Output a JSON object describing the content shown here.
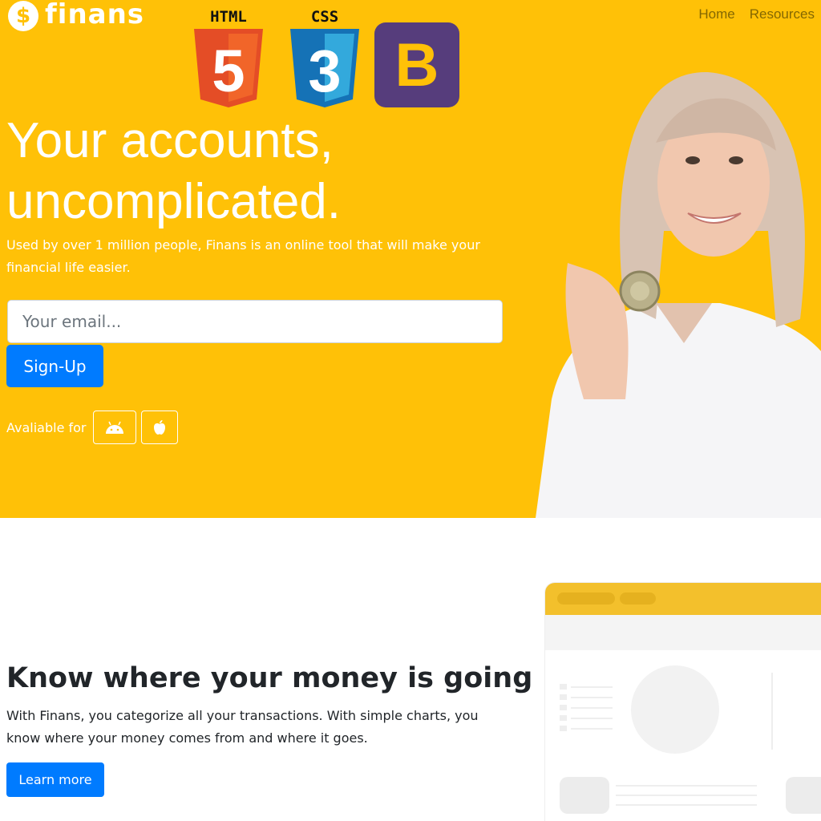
{
  "brand": {
    "name": "finans",
    "coin_symbol": "$"
  },
  "nav": {
    "items": [
      "Home",
      "Resources"
    ]
  },
  "badges": {
    "html_label": "HTML",
    "html_digit": "5",
    "css_label": "CSS",
    "css_digit": "3",
    "bootstrap_letter": "B"
  },
  "hero": {
    "headline_line1": "Your accounts,",
    "headline_line2": "uncomplicated.",
    "lead": "Used by over 1 million people, Finans is an online tool that will make your financial life easier.",
    "email_placeholder": "Your email...",
    "signup_label": "Sign-Up",
    "available_label": "Avaliable for",
    "platform_icons": [
      "android-icon",
      "apple-icon"
    ],
    "image": "woman-holding-coin"
  },
  "feature": {
    "title": "Know where your money is going",
    "text": "With Finans, you categorize all your transactions. With simple charts, you know where your money comes from and where it goes.",
    "button_label": "Learn more",
    "illustration": "app-dashboard-mockup"
  },
  "colors": {
    "primary_yellow": "#ffc107",
    "button_blue": "#007bff",
    "bootstrap_purple": "#563d7c",
    "html_orange": "#e44d26",
    "css_blue": "#1572b6"
  }
}
